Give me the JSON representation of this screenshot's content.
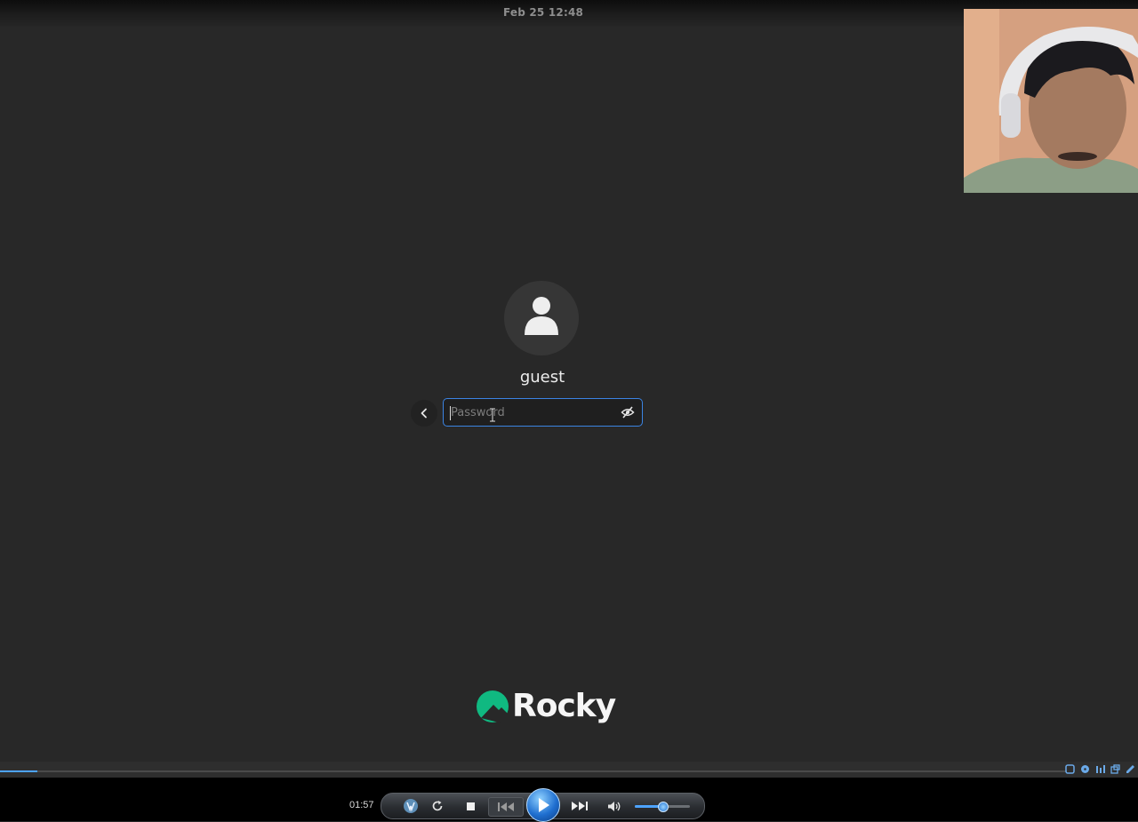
{
  "topbar": {
    "clock": "Feb 25  12:48"
  },
  "login": {
    "username": "guest",
    "password_placeholder": "Password",
    "accent_color": "#3b84e3"
  },
  "branding": {
    "logo_text": "Rocky",
    "logo_color": "#10b981"
  },
  "player": {
    "time": "01:57",
    "progress": 0.035,
    "volume": 0.5,
    "icons": [
      "media-library-icon",
      "repeat-icon",
      "stop-icon",
      "previous-icon",
      "play-icon",
      "next-icon",
      "volume-icon"
    ]
  }
}
